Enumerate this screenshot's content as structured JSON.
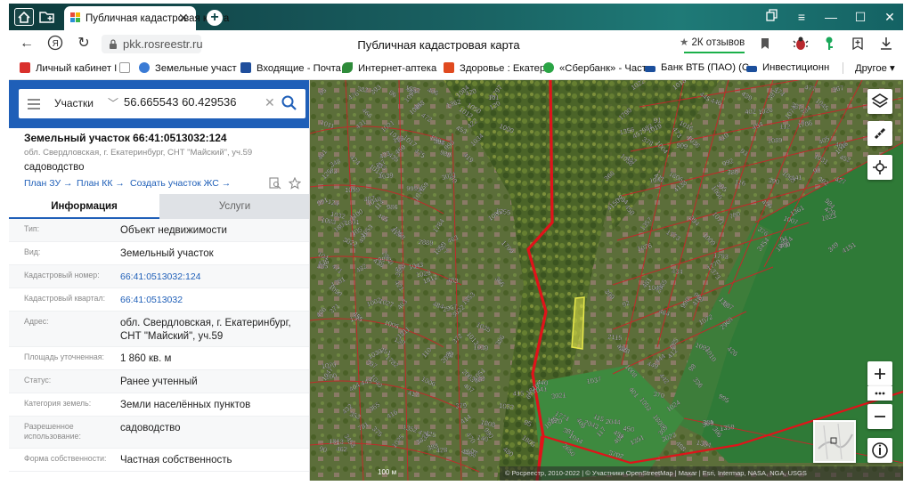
{
  "browser": {
    "tab_title": "Публичная кадастровая карта",
    "url": "pkk.rosreestr.ru",
    "page_title": "Публичная кадастровая карта",
    "reviews": "2К отзывов"
  },
  "bookmarks": [
    {
      "label": "Личный кабинет I",
      "color": "#d9302c"
    },
    {
      "label": "",
      "color": "#cccccc"
    },
    {
      "label": "Земельные участ",
      "color": "#3a7bd5"
    },
    {
      "label": "Входящие - Почта",
      "color": "#1f4e9c"
    },
    {
      "label": "Интернет-аптека",
      "color": "#2e8b3a"
    },
    {
      "label": "Здоровье : Екатер",
      "color": "#e04a1f"
    },
    {
      "label": "«Сбербанк» - Част",
      "color": "#2aa445"
    },
    {
      "label": "Банк ВТБ (ПАО) (С",
      "color": "#1b4f9c"
    },
    {
      "label": "Инвестиционн",
      "color": "#1b4f9c"
    }
  ],
  "bookmarks_other": "Другое",
  "search": {
    "type": "Участки",
    "value": "56.665543 60.429536"
  },
  "parcel": {
    "title": "Земельный участок 66:41:0513032:124",
    "address": "обл. Свердловская, г. Екатеринбург, СНТ \"Майский\", уч.59",
    "usage": "садоводство",
    "links": [
      "План ЗУ →",
      "План КК →",
      "Создать участок ЖС →"
    ]
  },
  "tabs": {
    "info": "Информация",
    "services": "Услуги"
  },
  "info_rows": [
    {
      "label": "Тип:",
      "value": "Объект недвижимости"
    },
    {
      "label": "Вид:",
      "value": "Земельный участок"
    },
    {
      "label": "Кадастровый номер:",
      "value": "66:41:0513032:124"
    },
    {
      "label": "Кадастровый квартал:",
      "value": "66:41:0513032"
    },
    {
      "label": "Адрес:",
      "value": "обл. Свердловская, г. Екатеринбург, СНТ \"Майский\", уч.59"
    },
    {
      "label": "Площадь уточненная:",
      "value": "1 860 кв. м"
    },
    {
      "label": "Статус:",
      "value": "Ранее учтенный"
    },
    {
      "label": "Категория земель:",
      "value": "Земли населённых пунктов"
    },
    {
      "label": "Разрешенное использование:",
      "value": "садоводство"
    },
    {
      "label": "Форма собственности:",
      "value": "Частная собственность"
    }
  ],
  "map": {
    "scale": "100 м",
    "attribution": "© Росреестр, 2010-2022 | © Участники OpenStreetMap | Maxar | Esri, Intermap, NASA, NGA, USGS",
    "labels": [
      "4639",
      "482",
      "909",
      "3453",
      "2888",
      "2889",
      "4138",
      "4151",
      "4150",
      "780",
      "781",
      "2967",
      "2968",
      "1853",
      "3022",
      "3023",
      "3021",
      "2038",
      "2063",
      "2065",
      "1065",
      "1066",
      "1083",
      "1084",
      "1092",
      "1093",
      "1091",
      "1090",
      "1089",
      "1099",
      "1100",
      "1051",
      "1052",
      "1053",
      "1070",
      "1071",
      "1072",
      "1074",
      "1075",
      "1076",
      "2044",
      "2043",
      "2650",
      "336",
      "3702",
      "3454",
      "1773",
      "1774",
      "1801",
      "1811",
      "1812",
      "1813",
      "1807",
      "1806",
      "1808",
      "1810",
      "1799",
      "1790",
      "1797",
      "1793",
      "1786",
      "1784",
      "1782",
      "1781",
      "1770",
      "1809",
      "1805",
      "1804",
      "1351",
      "1352",
      "1353",
      "1354",
      "1355",
      "1356",
      "1357",
      "1358",
      "1359",
      "1360",
      "1361",
      "1362",
      "480",
      "481",
      "483",
      "484",
      "485",
      "486",
      "487",
      "488",
      "96",
      "132",
      "124",
      "138",
      "140",
      "130",
      "125",
      "120",
      "117",
      "113",
      "114",
      "115",
      "116",
      "112",
      "110",
      "105",
      "104",
      "101",
      "100",
      "98",
      "97",
      "95",
      "94",
      "93",
      "92",
      "91",
      "90",
      "89",
      "88",
      "87",
      "86",
      "85",
      "84",
      "83",
      "982",
      "983",
      "984",
      "985",
      "986",
      "987",
      "988",
      "989",
      "990",
      "991",
      "992",
      "993",
      "994",
      "995",
      "996",
      "997",
      "998",
      "999",
      "1000",
      "1001",
      "1002",
      "1003",
      "1004",
      "1005",
      "1006",
      "1007",
      "1008",
      "1009",
      "1010",
      "1011",
      "1012",
      "1013",
      "1014",
      "1015",
      "1016",
      "1017",
      "1018",
      "1019",
      "1020",
      "1021",
      "1022",
      "1023",
      "1024",
      "1025",
      "1026",
      "1027",
      "1028",
      "1029",
      "1030",
      "1031",
      "1032",
      "1033",
      "1034",
      "1035",
      "1036",
      "1037",
      "1038",
      "1039",
      "1040",
      "1041",
      "1042",
      "1043",
      "1044",
      "1045",
      "1046",
      "1047",
      "1048",
      "1049",
      "1050",
      "2115",
      "3021",
      "3022",
      "348",
      "349",
      "350",
      "351",
      "352",
      "364",
      "365",
      "366",
      "367",
      "368",
      "369",
      "370",
      "371",
      "372",
      "373",
      "374",
      "375",
      "376",
      "377",
      "378",
      "379",
      "380",
      "381",
      "382",
      "383",
      "384",
      "385",
      "386",
      "387",
      "388",
      "389",
      "390",
      "391",
      "392",
      "393",
      "394",
      "395",
      "396",
      "397",
      "398",
      "399",
      "400",
      "401",
      "402",
      "403",
      "404",
      "405",
      "406",
      "407",
      "408",
      "409",
      "410",
      "411",
      "412",
      "413",
      "414",
      "415",
      "416",
      "417",
      "418",
      "419",
      "420",
      "421",
      "422",
      "423",
      "424",
      "425",
      "426",
      "427",
      "428",
      "429",
      "430",
      "431",
      "432",
      "433",
      "434",
      "435",
      "436",
      "437",
      "438",
      "439",
      "440",
      "441",
      "442",
      "443",
      "444",
      "445",
      "446",
      "447",
      "448",
      "449",
      "450",
      "451",
      "452",
      "453",
      "454",
      "455",
      "456",
      "457",
      "458",
      "459",
      "460",
      "461",
      "462",
      "463",
      "464",
      "465",
      "466",
      "467",
      "468",
      "469",
      "470",
      "471",
      "472",
      "473",
      "474",
      "475",
      "476",
      "477",
      "478",
      "479"
    ]
  }
}
